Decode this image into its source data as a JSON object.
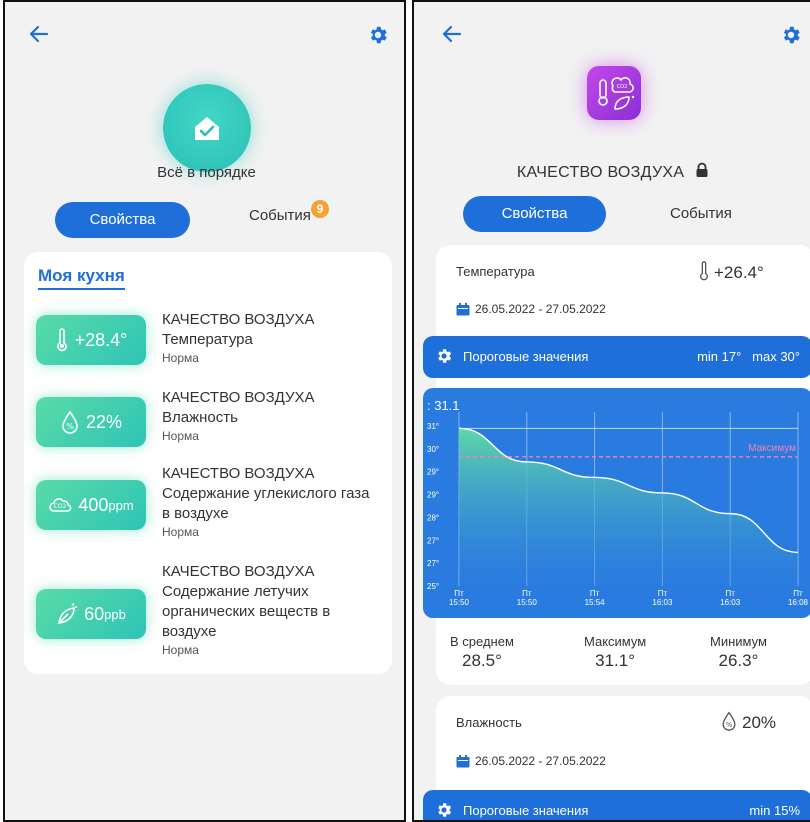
{
  "left": {
    "status": "Всё в порядке",
    "tabs": {
      "active": "Свойства",
      "other": "События",
      "badge": "9"
    },
    "room": "Моя кухня",
    "items": [
      {
        "icon": "thermometer-icon",
        "value": "+28.4°",
        "unit": "",
        "title": "КАЧЕСТВО ВОЗДУХА",
        "subtitle": "Температура",
        "status": "Норма"
      },
      {
        "icon": "humidity-icon",
        "value": "22%",
        "unit": "",
        "title": "КАЧЕСТВО ВОЗДУХА",
        "subtitle": "Влажность",
        "status": "Норма"
      },
      {
        "icon": "co2-icon",
        "value": "400",
        "unit": "ppm",
        "title": "КАЧЕСТВО ВОЗДУХА",
        "subtitle": "Содержание углекислого газа в воздухе",
        "status": "Норма"
      },
      {
        "icon": "voc-icon",
        "value": "60",
        "unit": "ppb",
        "title": "КАЧЕСТВО ВОЗДУХА",
        "subtitle": "Содержание летучих органических веществ в воздухе",
        "status": "Норма"
      }
    ]
  },
  "right": {
    "title": "КАЧЕСТВО ВОЗДУХА",
    "tabs": {
      "active": "Свойства",
      "other": "События"
    },
    "temperature": {
      "name": "Температура",
      "value": "+26.4°",
      "date_range": "26.05.2022 - 27.05.2022",
      "threshold_label": "Пороговые значения",
      "min": "min 17°",
      "max": "max 30°",
      "stats": {
        "avg_label": "В среднем",
        "avg": "28.5°",
        "max_label": "Максимум",
        "max": "31.1°",
        "min_label": "Минимум",
        "min": "26.3°"
      }
    },
    "humidity": {
      "name": "Влажность",
      "value": "20%",
      "date_range": "26.05.2022 - 27.05.2022",
      "threshold_label": "Пороговые значения",
      "min": "min 15%"
    }
  },
  "chart_data": {
    "type": "area",
    "x": [
      "Пт 15:50",
      "Пт 15:50",
      "Пт 15:54",
      "Пт 16:03",
      "Пт 16:03",
      "Пт 16:08"
    ],
    "y": [
      31.1,
      29.8,
      29.2,
      28.6,
      27.8,
      26.3
    ],
    "x_ticks": [
      "Пт\n15:50",
      "Пт\n15:50",
      "Пт\n15:54",
      "Пт\n16:03",
      "Пт\n16:03",
      "Пт\n16:08"
    ],
    "y_ticks": [
      "25°",
      "27°",
      "27°",
      "28°",
      "29°",
      "29°",
      "30°",
      "31°"
    ],
    "top_label": "31.1",
    "threshold": {
      "label": "Максимум",
      "value": 30
    },
    "ylim": [
      25,
      31.5
    ],
    "colors": {
      "background": "#2a7be0",
      "fill_top": "#5fd8a8",
      "fill_bottom": "#2a7be0",
      "threshold": "#ff7fa6"
    }
  }
}
